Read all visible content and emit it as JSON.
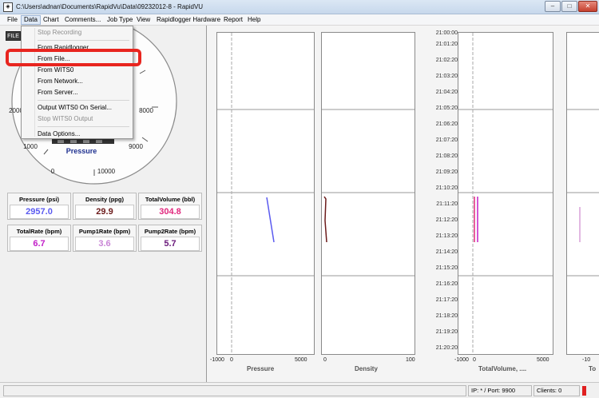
{
  "window": {
    "title": "C:\\Users\\adnan\\Documents\\RapidVu\\Data\\09232012-8 - RapidVU",
    "minimize": "–",
    "maximize": "□",
    "close": "✕"
  },
  "menu": [
    "File",
    "Data",
    "Chart",
    "Comments...",
    "Job Type",
    "View",
    "Rapidlogger Hardware",
    "Report",
    "Help"
  ],
  "data_menu": {
    "items": [
      {
        "label": "Stop Recording",
        "enabled": false
      },
      {
        "label": "From Rapidlogger",
        "enabled": true
      },
      {
        "label": "From File...",
        "enabled": true,
        "highlighted": true
      },
      {
        "label": "From WITS0",
        "enabled": true
      },
      {
        "label": "From Network...",
        "enabled": true
      },
      {
        "label": "From Server...",
        "enabled": true
      },
      {
        "label": "Output WITS0 On Serial...",
        "enabled": true
      },
      {
        "label": "Stop WITS0 Output",
        "enabled": false
      },
      {
        "label": "Data Options...",
        "enabled": true
      }
    ]
  },
  "gauge": {
    "badge": "FILE",
    "title": "Pressure",
    "ticks": [
      "0",
      "1000",
      "2000",
      "8000",
      "9000",
      "10000"
    ]
  },
  "readouts": [
    {
      "label": "Pressure (psi)",
      "value": "2957.0",
      "color": "#5a5af0"
    },
    {
      "label": "Density (ppg)",
      "value": "29.9",
      "color": "#6b1a1a"
    },
    {
      "label": "TotalVolume (bbl)",
      "value": "304.8",
      "color": "#e0287d"
    },
    {
      "label": "TotalRate (bpm)",
      "value": "6.7",
      "color": "#c21ec8"
    },
    {
      "label": "Pump1Rate (bpm)",
      "value": "3.6",
      "color": "#c985d6"
    },
    {
      "label": "Pump2Rate (bpm)",
      "value": "5.7",
      "color": "#6a1a7a"
    }
  ],
  "chart": {
    "times": [
      "21:00:00",
      "21:01:20",
      "21:02:20",
      "21:03:20",
      "21:04:20",
      "21:05:20",
      "21:06:20",
      "21:07:20",
      "21:08:20",
      "21:09:20",
      "21:10:20",
      "21:11:20",
      "21:12:20",
      "21:13:20",
      "21:14:20",
      "21:15:20",
      "21:16:20",
      "21:17:20",
      "21:18:20",
      "21:19:20",
      "21:20:20"
    ],
    "strips": [
      {
        "name": "Pressure",
        "axis": [
          "-1000",
          "0",
          "5000"
        ],
        "color": "#5a5af0"
      },
      {
        "name": "Density",
        "axis": [
          "0",
          "100"
        ],
        "color": "#6b1a1a"
      },
      {
        "name": "TotalVolume, ....",
        "axis": [
          "-1000",
          "0",
          "5000"
        ],
        "color": "#e0287d"
      },
      {
        "name": "To",
        "axis": [
          "-10"
        ],
        "color": "#d9a0d9"
      }
    ]
  },
  "status": {
    "ip": "IP: * / Port: 9900",
    "clients": "Clients: 0"
  }
}
